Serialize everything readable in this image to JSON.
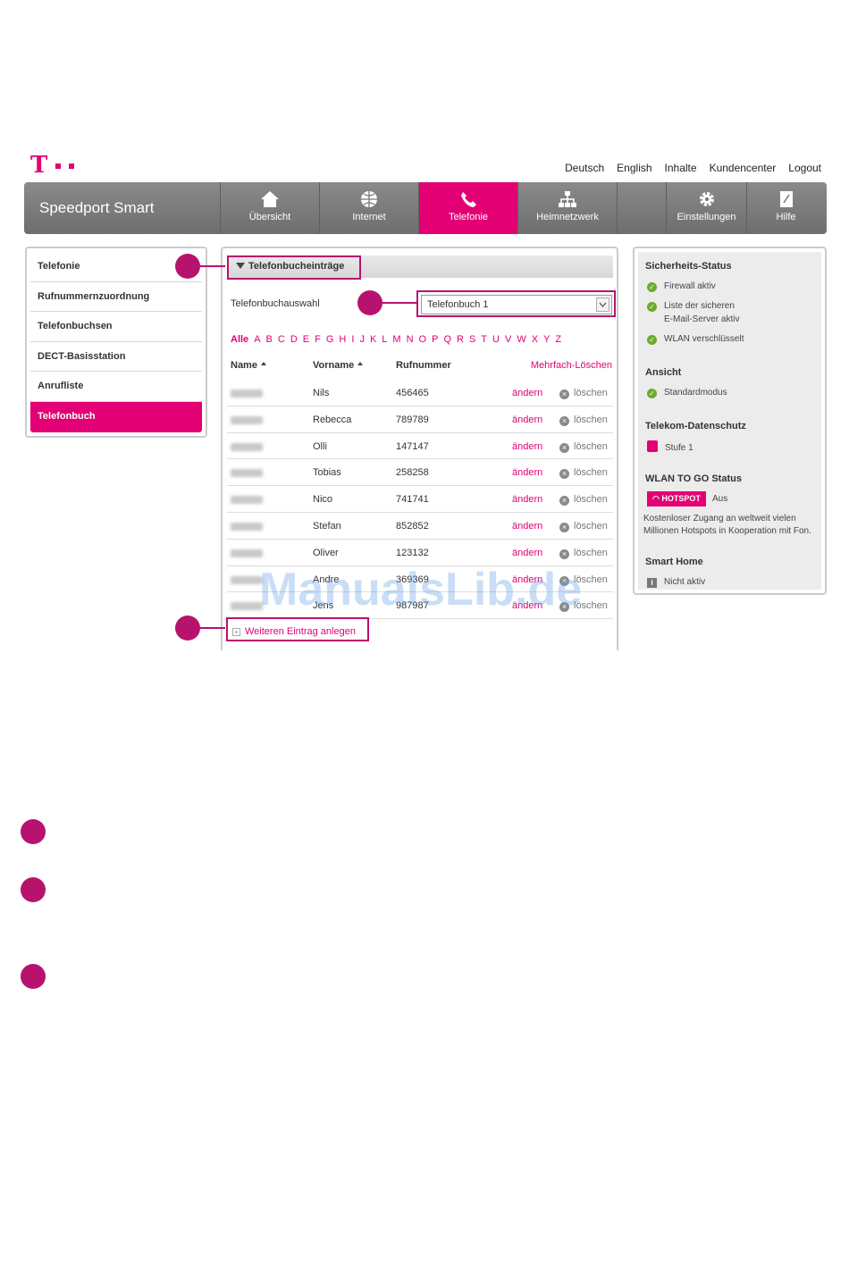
{
  "colors": {
    "accent": "#e20074",
    "callout": "#b8126f",
    "nav_gray": "#7a7a7a",
    "ok_green": "#6bab2e"
  },
  "top_links": [
    "Deutsch",
    "English",
    "Inhalte",
    "Kundencenter",
    "Logout"
  ],
  "nav": {
    "brand": "Speedport Smart",
    "items": [
      {
        "label": "Übersicht",
        "icon": "home-icon"
      },
      {
        "label": "Internet",
        "icon": "globe-icon"
      },
      {
        "label": "Telefonie",
        "icon": "phone-icon",
        "active": true
      },
      {
        "label": "Heimnetzwerk",
        "icon": "network-icon"
      },
      {
        "label": "",
        "icon": ""
      },
      {
        "label": "Einstellungen",
        "icon": "gear-icon"
      },
      {
        "label": "Hilfe",
        "icon": "help-book-icon"
      }
    ]
  },
  "sidebar": {
    "items": [
      "Telefonie",
      "Rufnummernzuordnung",
      "Telefonbuchsen",
      "DECT-Basisstation",
      "Anrufliste",
      "Telefonbuch"
    ],
    "active_index": 5
  },
  "main": {
    "section_title": "Telefonbucheinträge",
    "select_label": "Telefonbuchauswahl",
    "select_value": "Telefonbuch 1",
    "alphabet": [
      "Alle",
      "A",
      "B",
      "C",
      "D",
      "E",
      "F",
      "G",
      "H",
      "I",
      "J",
      "K",
      "L",
      "M",
      "N",
      "O",
      "P",
      "Q",
      "R",
      "S",
      "T",
      "U",
      "V",
      "W",
      "X",
      "Y",
      "Z"
    ],
    "columns": {
      "name": "Name",
      "first": "Vorname",
      "number": "Rufnummer",
      "multi_delete": "Mehrfach-Löschen"
    },
    "edit_label": "ändern",
    "delete_label": "löschen",
    "rows": [
      {
        "first": "Nils",
        "number": "456465"
      },
      {
        "first": "Rebecca",
        "number": "789789"
      },
      {
        "first": "Olli",
        "number": "147147"
      },
      {
        "first": "Tobias",
        "number": "258258"
      },
      {
        "first": "Nico",
        "number": "741741"
      },
      {
        "first": "Stefan",
        "number": "852852"
      },
      {
        "first": "Oliver",
        "number": "123132"
      },
      {
        "first": "Andre",
        "number": "369369"
      },
      {
        "first": "Jens",
        "number": "987987"
      }
    ],
    "add_entry": "Weiteren Eintrag anlegen"
  },
  "status": {
    "security_title": "Sicherheits-Status",
    "firewall": "Firewall aktiv",
    "mail_line1": "Liste der sicheren",
    "mail_line2": "E-Mail-Server aktiv",
    "wlan": "WLAN verschlüsselt",
    "view_title": "Ansicht",
    "view_mode": "Standardmodus",
    "privacy_title": "Telekom-Datenschutz",
    "privacy_level": "Stufe 1",
    "wlan_to_go_title": "WLAN TO GO Status",
    "hotspot_badge": "HOTSPOT",
    "hotspot_state": "Aus",
    "hotspot_desc1": "Kostenloser Zugang an weltweit vielen",
    "hotspot_desc2": "Millionen Hotspots in Kooperation mit Fon.",
    "smarthome_title": "Smart Home",
    "smarthome_state": "Nicht aktiv"
  },
  "watermark": "ManualsLib.de"
}
